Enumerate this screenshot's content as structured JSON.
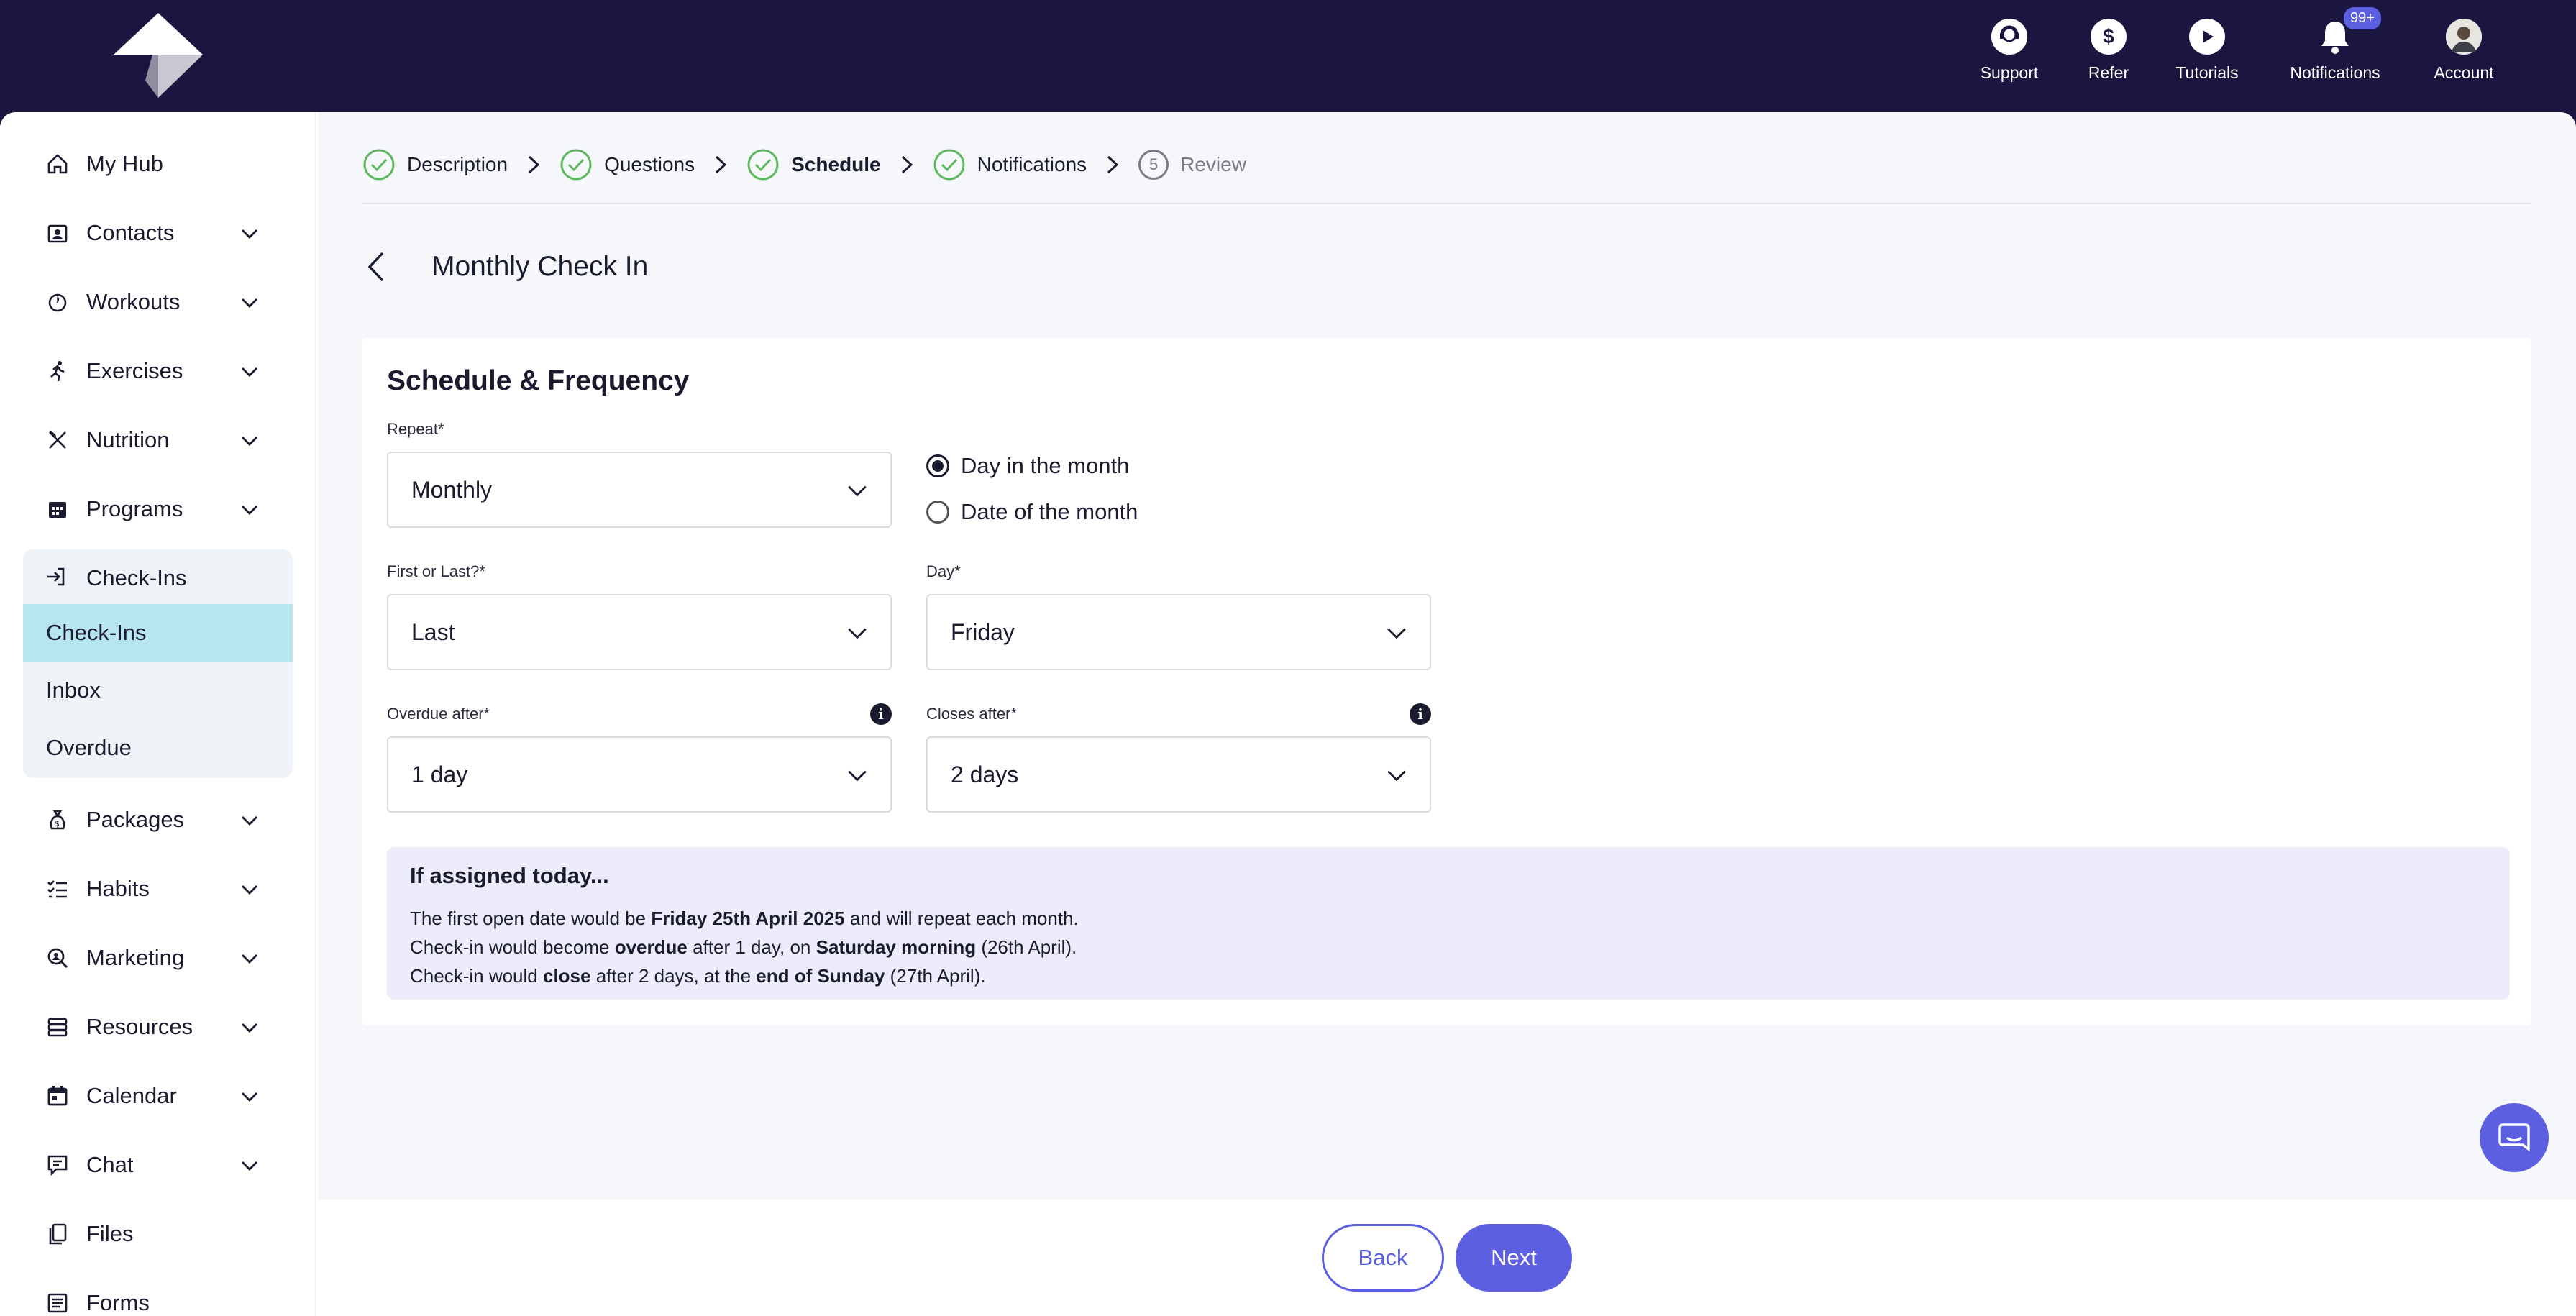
{
  "topbar": {
    "items": [
      {
        "label": "Support",
        "icon": "support-icon"
      },
      {
        "label": "Refer",
        "icon": "dollar-icon"
      },
      {
        "label": "Tutorials",
        "icon": "play-icon"
      },
      {
        "label": "Notifications",
        "icon": "bell-icon",
        "badge": "99+"
      },
      {
        "label": "Account",
        "icon": "avatar"
      }
    ]
  },
  "sidebar": {
    "items": [
      {
        "label": "My Hub",
        "icon": "home-icon"
      },
      {
        "label": "Contacts",
        "icon": "contacts-icon"
      },
      {
        "label": "Workouts",
        "icon": "workouts-icon"
      },
      {
        "label": "Exercises",
        "icon": "running-icon"
      },
      {
        "label": "Nutrition",
        "icon": "utensils-icon"
      },
      {
        "label": "Programs",
        "icon": "calendar-grid-icon"
      },
      {
        "label": "Packages",
        "icon": "money-bag-icon"
      },
      {
        "label": "Habits",
        "icon": "checklist-icon"
      },
      {
        "label": "Marketing",
        "icon": "magnifier-icon"
      },
      {
        "label": "Resources",
        "icon": "stack-icon"
      },
      {
        "label": "Calendar",
        "icon": "calendar-icon"
      },
      {
        "label": "Chat",
        "icon": "chat-icon"
      },
      {
        "label": "Files",
        "icon": "files-icon"
      },
      {
        "label": "Forms",
        "icon": "forms-icon"
      }
    ],
    "checkins": {
      "header": "Check-Ins",
      "sub_items": [
        "Check-Ins",
        "Inbox",
        "Overdue"
      ]
    }
  },
  "stepper": {
    "steps": [
      {
        "label": "Description",
        "state": "done"
      },
      {
        "label": "Questions",
        "state": "done"
      },
      {
        "label": "Schedule",
        "state": "current"
      },
      {
        "label": "Notifications",
        "state": "done"
      },
      {
        "label": "Review",
        "state": "pending",
        "number": "5"
      }
    ]
  },
  "page": {
    "title": "Monthly Check In"
  },
  "schedule": {
    "title": "Schedule & Frequency",
    "repeat": {
      "label": "Repeat*",
      "value": "Monthly"
    },
    "mode_options": [
      {
        "label": "Day in the month",
        "selected": true
      },
      {
        "label": "Date of the month",
        "selected": false
      }
    ],
    "first_or_last": {
      "label": "First or Last?*",
      "value": "Last"
    },
    "day": {
      "label": "Day*",
      "value": "Friday"
    },
    "overdue_after": {
      "label": "Overdue after*",
      "value": "1 day"
    },
    "closes_after": {
      "label": "Closes after*",
      "value": "2 days"
    }
  },
  "summary": {
    "title": "If assigned today...",
    "line1": {
      "a": "The first open date would be ",
      "b": "Friday 25th April 2025",
      "c": " and will repeat each month."
    },
    "line2": {
      "a": "Check-in would become ",
      "b": "overdue",
      "c": " after 1 day, on ",
      "d": "Saturday morning",
      "e": " (26th April)."
    },
    "line3": {
      "a": "Check-in would ",
      "b": "close",
      "c": " after 2 days, at the ",
      "d": "end of Sunday",
      "e": " (27th April)."
    }
  },
  "footer": {
    "back_label": "Back",
    "next_label": "Next"
  },
  "colors": {
    "accent": "#5b5fe0",
    "topbar": "#1a1640",
    "done": "#5cb85c",
    "active_subitem": "#b7e6ee"
  }
}
